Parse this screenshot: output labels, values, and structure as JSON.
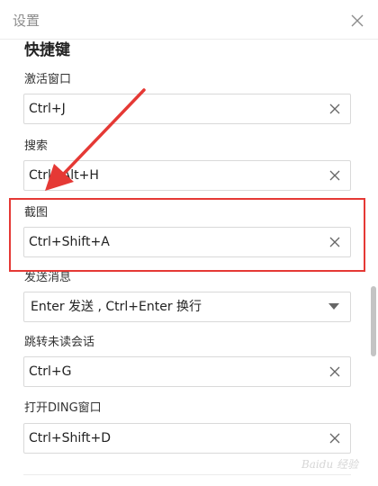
{
  "dialog": {
    "title": "设置"
  },
  "section": {
    "title": "快捷键"
  },
  "shortcuts": [
    {
      "label": "激活窗口",
      "value": "Ctrl+J"
    },
    {
      "label": "搜索",
      "value": "Ctrl+Alt+H"
    },
    {
      "label": "截图",
      "value": "Ctrl+Shift+A"
    },
    {
      "label": "发送消息",
      "value": "Enter 发送 , Ctrl+Enter 换行"
    },
    {
      "label": "跳转未读会话",
      "value": "Ctrl+G"
    },
    {
      "label": "打开DING窗口",
      "value": "Ctrl+Shift+D"
    }
  ],
  "icons": {
    "close": "close-icon",
    "clear": "clear-icon",
    "dropdown": "chevron-down-icon"
  },
  "annotation": {
    "color": "#e53935"
  },
  "watermark": {
    "text": "Baidu 经验"
  }
}
